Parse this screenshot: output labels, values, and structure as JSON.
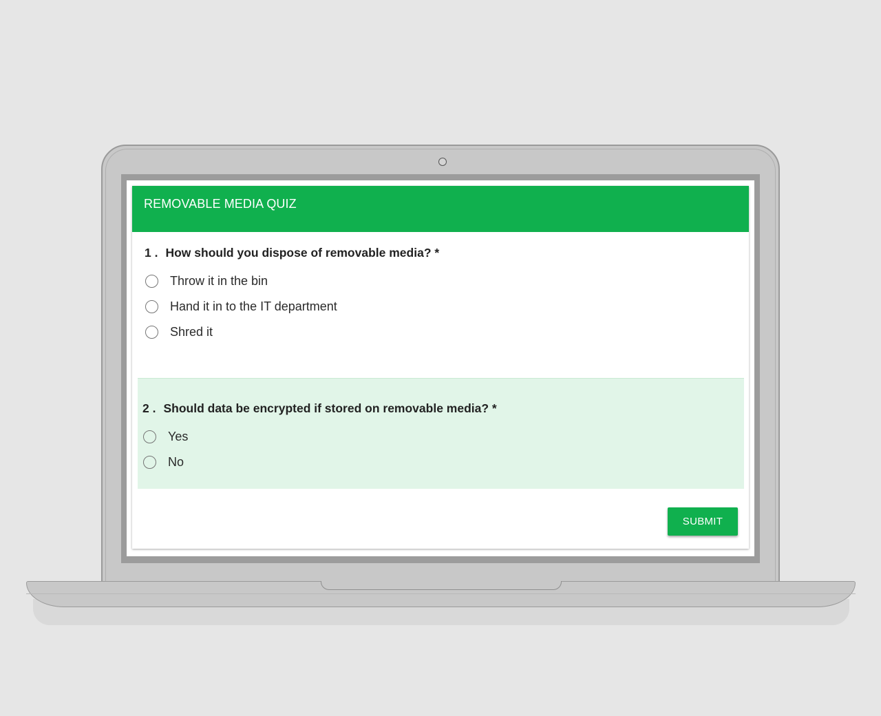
{
  "quiz": {
    "title": "REMOVABLE MEDIA QUIZ",
    "questions": [
      {
        "number": "1 .",
        "text": "How should you dispose of removable media? *",
        "options": [
          "Throw it in the bin",
          "Hand it in to the IT department",
          "Shred it"
        ]
      },
      {
        "number": "2 .",
        "text": "Should data be encrypted if stored on removable media? *",
        "options": [
          "Yes",
          "No"
        ]
      }
    ],
    "submit_label": "SUBMIT"
  },
  "colors": {
    "accent": "#10b04e",
    "highlight": "#e1f5e8",
    "background": "#e6e6e6",
    "laptop_body": "#c8c8c8"
  }
}
